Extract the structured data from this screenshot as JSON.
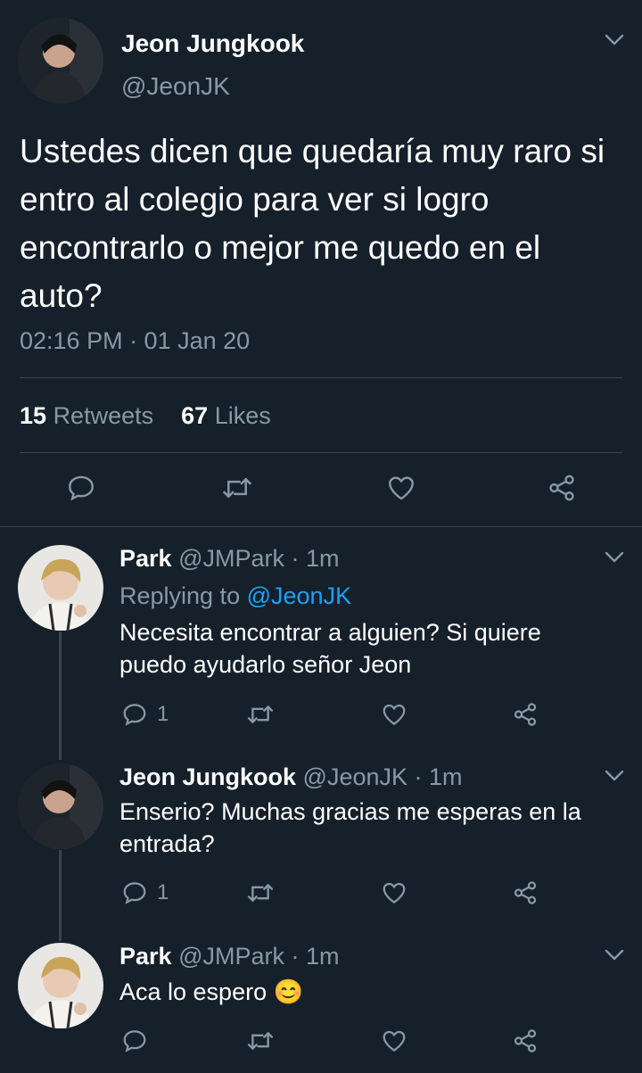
{
  "main_tweet": {
    "author_name": "Jeon Jungkook",
    "author_handle": "@JeonJK",
    "text": "Ustedes dicen que quedaría muy raro si entro al colegio para ver si logro encontrarlo o mejor me quedo en el auto?",
    "timestamp": "02:16 PM · 01 Jan 20",
    "retweets_count": "15",
    "retweets_label": "Retweets",
    "likes_count": "67",
    "likes_label": "Likes"
  },
  "replies": [
    {
      "author_name": "Park",
      "meta": "@JMPark · 1m",
      "replying_prefix": "Replying to",
      "replying_handle": "@JeonJK",
      "text_line1": "Necesita encontrar a alguien? Si quiere",
      "text_line2": "puedo ayudarlo señor Jeon",
      "reply_count": "1"
    },
    {
      "author_name": "Jeon Jungkook",
      "meta": "@JeonJK · 1m",
      "text_line1": "Enserio? Muchas gracias me esperas en la",
      "text_line2": "entrada?",
      "reply_count": "1"
    },
    {
      "author_name": "Park",
      "meta": "@JMPark · 1m",
      "text_line1": "Aca lo espero 😊"
    }
  ],
  "colors": {
    "background": "#15202b",
    "muted": "#8899a6",
    "accent": "#1da1f2",
    "divider": "#38444d"
  },
  "icons": [
    "reply-icon",
    "retweet-icon",
    "like-icon",
    "share-icon",
    "chevron-down-icon"
  ]
}
